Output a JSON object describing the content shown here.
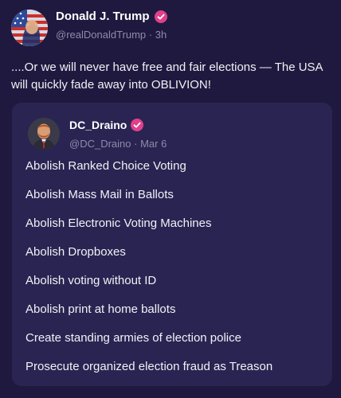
{
  "post": {
    "author": {
      "display_name": "Donald J. Trump",
      "handle": "@realDonaldTrump",
      "separator": "·",
      "time": "3h",
      "verified": true
    },
    "text": "....Or we will never have free and fair elections — The USA will quickly fade away into OBLIVION!",
    "quote": {
      "author": {
        "display_name": "DC_Draino",
        "handle": "@DC_Draino",
        "separator": "·",
        "time": "Mar 6",
        "verified": true
      },
      "lines": [
        "Abolish Ranked Choice Voting",
        "Abolish Mass Mail in Ballots",
        "Abolish Electronic Voting Machines",
        "Abolish Dropboxes",
        "Abolish voting without ID",
        "Abolish print at home ballots",
        "Create standing armies of election police",
        "Prosecute organized election fraud as Treason"
      ]
    }
  },
  "colors": {
    "background": "#20193f",
    "card": "#2a2452",
    "verified_badge": "#e0408a",
    "muted_text": "#8f8aa9"
  }
}
